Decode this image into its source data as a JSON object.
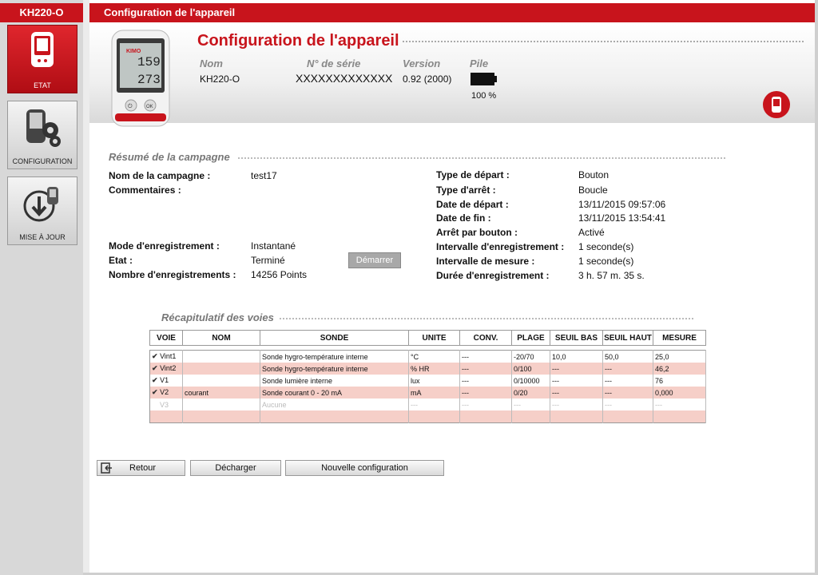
{
  "sidebar": {
    "device_label": "KH220-O",
    "items": [
      {
        "label": "ETAT",
        "icon": "device-icon",
        "active": true
      },
      {
        "label": "CONFIGURATION",
        "icon": "config-icon",
        "active": false
      },
      {
        "label": "MISE À JOUR",
        "icon": "update-icon",
        "active": false
      }
    ]
  },
  "topbar": {
    "title": "Configuration de l'appareil"
  },
  "header": {
    "title": "Configuration de l'appareil",
    "name_label": "Nom",
    "serial_label": "N° de série",
    "version_label": "Version",
    "battery_label": "Pile",
    "name_value": "KH220-O",
    "serial_value": "XXXXXXXXXXXXX",
    "version_value": "0.92 (2000)",
    "battery_value": "100 %",
    "battery_level": 1.0,
    "device_display_top": "159",
    "device_display_bottom": "273",
    "device_brand": "KIMO",
    "device_button_left": "⏻",
    "device_button_right": "OK"
  },
  "campaign": {
    "section_title": "Résumé de la campagne",
    "name_label": "Nom de la campagne :",
    "name_value": "test17",
    "comments_label": "Commentaires :",
    "mode_label": "Mode d'enregistrement :",
    "mode_value": "Instantané",
    "state_label": "Etat :",
    "state_value": "Terminé",
    "count_label": "Nombre d'enregistrements :",
    "count_value": "14256 Points",
    "start_button": "Démarrer",
    "start_type_label": "Type de départ :",
    "start_type_value": "Bouton",
    "stop_type_label": "Type d'arrêt :",
    "stop_type_value": "Boucle",
    "start_date_label": "Date de départ :",
    "start_date_value": "13/11/2015 09:57:06",
    "end_date_label": "Date de fin :",
    "end_date_value": "13/11/2015 13:54:41",
    "stop_button_label": "Arrêt par bouton :",
    "stop_button_value": "Activé",
    "rec_interval_label": "Intervalle d'enregistrement :",
    "rec_interval_value": "1 seconde(s)",
    "meas_interval_label": "Intervalle de mesure :",
    "meas_interval_value": "1 seconde(s)",
    "duration_label": "Durée d'enregistrement :",
    "duration_value": "3 h. 57 m. 35 s."
  },
  "channels": {
    "section_title": "Récapitulatif des voies",
    "headers": [
      "VOIE",
      "NOM",
      "SONDE",
      "UNITE",
      "CONV.",
      "PLAGE",
      "SEUIL BAS",
      "SEUIL HAUT",
      "MESURE"
    ],
    "rows": [
      {
        "checked": true,
        "cells": [
          "Vint1",
          "",
          "Sonde hygro-température interne",
          "°C",
          "---",
          "-20/70",
          "10,0",
          "50,0",
          "25,0"
        ],
        "enabled": true
      },
      {
        "checked": true,
        "cells": [
          "Vint2",
          "",
          "Sonde hygro-température interne",
          "% HR",
          "---",
          "0/100",
          "---",
          "---",
          "46,2"
        ],
        "enabled": true
      },
      {
        "checked": true,
        "cells": [
          "V1",
          "",
          "Sonde lumière interne",
          "lux",
          "---",
          "0/10000",
          "---",
          "---",
          "76"
        ],
        "enabled": true
      },
      {
        "checked": true,
        "cells": [
          "V2",
          "courant",
          "Sonde courant 0 - 20 mA",
          "mA",
          "---",
          "0/20",
          "---",
          "---",
          "0,000"
        ],
        "enabled": true
      },
      {
        "checked": false,
        "cells": [
          "V3",
          "",
          "Aucune",
          "---",
          "---",
          "---",
          "---",
          "---",
          "---"
        ],
        "enabled": false
      },
      {
        "checked": false,
        "cells": [
          "",
          "",
          "",
          "",
          "",
          "",
          "",
          "",
          ""
        ],
        "enabled": false
      }
    ]
  },
  "footer": {
    "back_label": "Retour",
    "download_label": "Décharger",
    "new_config_label": "Nouvelle configuration"
  }
}
